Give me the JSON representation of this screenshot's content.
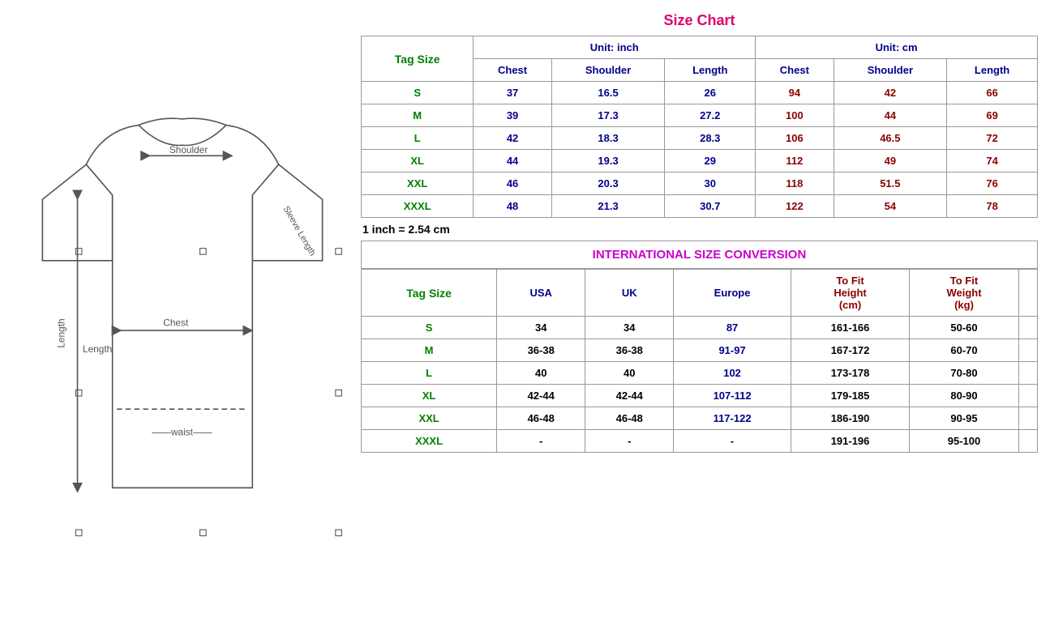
{
  "sizeChart": {
    "title": "Size Chart",
    "note": "1 inch = 2.54 cm",
    "unitInch": "Unit: inch",
    "unitCm": "Unit: cm",
    "tagSizeLabel": "Tag Size",
    "inchCols": [
      "Chest",
      "Shoulder",
      "Length"
    ],
    "cmCols": [
      "Chest",
      "Shoulder",
      "Length"
    ],
    "rows": [
      {
        "tag": "S",
        "inch": [
          "37",
          "16.5",
          "26"
        ],
        "cm": [
          "94",
          "42",
          "66"
        ]
      },
      {
        "tag": "M",
        "inch": [
          "39",
          "17.3",
          "27.2"
        ],
        "cm": [
          "100",
          "44",
          "69"
        ]
      },
      {
        "tag": "L",
        "inch": [
          "42",
          "18.3",
          "28.3"
        ],
        "cm": [
          "106",
          "46.5",
          "72"
        ]
      },
      {
        "tag": "XL",
        "inch": [
          "44",
          "19.3",
          "29"
        ],
        "cm": [
          "112",
          "49",
          "74"
        ]
      },
      {
        "tag": "XXL",
        "inch": [
          "46",
          "20.3",
          "30"
        ],
        "cm": [
          "118",
          "51.5",
          "76"
        ]
      },
      {
        "tag": "XXXL",
        "inch": [
          "48",
          "21.3",
          "30.7"
        ],
        "cm": [
          "122",
          "54",
          "78"
        ]
      }
    ]
  },
  "conversion": {
    "title": "INTERNATIONAL SIZE CONVERSION",
    "tagSizeLabel": "Tag Size",
    "cols": [
      "USA",
      "UK",
      "Europe",
      "To Fit Height (cm)",
      "To Fit Weight (kg)"
    ],
    "rows": [
      {
        "tag": "S",
        "usa": "34",
        "uk": "34",
        "europe": "87",
        "height": "161-166",
        "weight": "50-60"
      },
      {
        "tag": "M",
        "usa": "36-38",
        "uk": "36-38",
        "europe": "91-97",
        "height": "167-172",
        "weight": "60-70"
      },
      {
        "tag": "L",
        "usa": "40",
        "uk": "40",
        "europe": "102",
        "height": "173-178",
        "weight": "70-80"
      },
      {
        "tag": "XL",
        "usa": "42-44",
        "uk": "42-44",
        "europe": "107-112",
        "height": "179-185",
        "weight": "80-90"
      },
      {
        "tag": "XXL",
        "usa": "46-48",
        "uk": "46-48",
        "europe": "117-122",
        "height": "186-190",
        "weight": "90-95"
      },
      {
        "tag": "XXXL",
        "usa": "-",
        "uk": "-",
        "europe": "-",
        "height": "191-196",
        "weight": "95-100"
      }
    ]
  },
  "tofitHeight": "To Fit\nHeight\n(cm)",
  "tofitWeight": "To Fit\nWeight\n(kg)"
}
